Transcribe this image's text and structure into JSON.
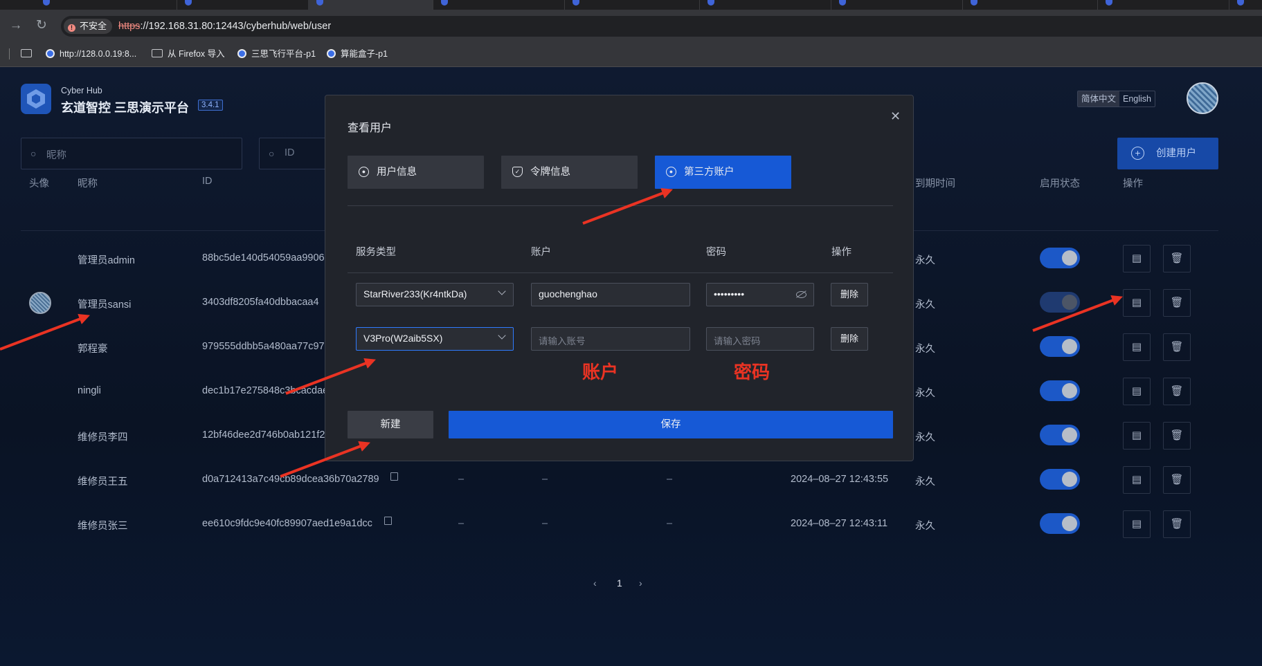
{
  "browser": {
    "security_label": "不安全",
    "url_scheme": "https",
    "url_rest": "://192.168.31.80:12443/cyberhub/web/user",
    "bookmarks": [
      "http://128.0.0.19:8...",
      "从 Firefox 导入",
      "三思飞行平台-p1",
      "算能盒子-p1"
    ]
  },
  "app": {
    "brand_sub": "Cyber Hub",
    "brand_title": "玄道智控 三思演示平台",
    "version": "3.4.1",
    "lang_zh": "简体中文",
    "lang_en": "English",
    "search_nickname_placeholder": "昵称",
    "search_id_placeholder": "ID",
    "create_label": "创建用户"
  },
  "table": {
    "headers": {
      "avatar": "头像",
      "nickname": "昵称",
      "id": "ID",
      "expire": "到期时间",
      "status": "启用状态",
      "actions": "操作"
    },
    "rows": [
      {
        "nickname": "管理员admin",
        "id": "88bc5de140d54059aa9906",
        "c3": "",
        "c4": "",
        "c5": "",
        "created": "",
        "expire": "永久",
        "enabled": true
      },
      {
        "nickname": "管理员sansi",
        "id": "3403df8205fa40dbbacaa4",
        "c3": "",
        "c4": "",
        "c5": "",
        "created": "",
        "expire": "永久",
        "enabled": false
      },
      {
        "nickname": "郭程豪",
        "id": "979555ddbb5a480aa77c97",
        "c3": "",
        "c4": "",
        "c5": "",
        "created": "",
        "expire": "永久",
        "enabled": true
      },
      {
        "nickname": "ningli",
        "id": "dec1b17e275848c3bcacdae",
        "c3": "",
        "c4": "",
        "c5": "",
        "created": "",
        "expire": "永久",
        "enabled": true
      },
      {
        "nickname": "维修员李四",
        "id": "12bf46dee2d746b0ab121f2",
        "c3": "",
        "c4": "",
        "c5": "",
        "created": "",
        "expire": "永久",
        "enabled": true
      },
      {
        "nickname": "维修员王五",
        "id": "d0a712413a7c49cb89dcea36b70a2789",
        "c3": "–",
        "c4": "–",
        "c5": "–",
        "created": "2024–08–27 12:43:55",
        "expire": "永久",
        "enabled": true
      },
      {
        "nickname": "维修员张三",
        "id": "ee610c9fdc9e40fc89907aed1e9a1dcc",
        "c3": "–",
        "c4": "–",
        "c5": "–",
        "created": "2024–08–27 12:43:11",
        "expire": "永久",
        "enabled": true
      }
    ]
  },
  "pagination": {
    "page": "1"
  },
  "modal": {
    "title": "查看用户",
    "tabs": [
      "用户信息",
      "令牌信息",
      "第三方账户"
    ],
    "active_tab": 2,
    "headers": {
      "service": "服务类型",
      "account": "账户",
      "password": "密码",
      "actions": "操作"
    },
    "rows": [
      {
        "service": "StarRiver233(Kr4ntkDa)",
        "account": "guochenghao",
        "account_placeholder": "",
        "password": "•••••••••",
        "password_placeholder": "",
        "delete": "删除"
      },
      {
        "service": "V3Pro(W2aib5SX)",
        "account": "",
        "account_placeholder": "请输入账号",
        "password": "",
        "password_placeholder": "请输入密码",
        "delete": "删除"
      }
    ],
    "new_label": "新建",
    "save_label": "保存"
  },
  "annotations": {
    "account": "账户",
    "password": "密码",
    "color": "#ea3323"
  }
}
